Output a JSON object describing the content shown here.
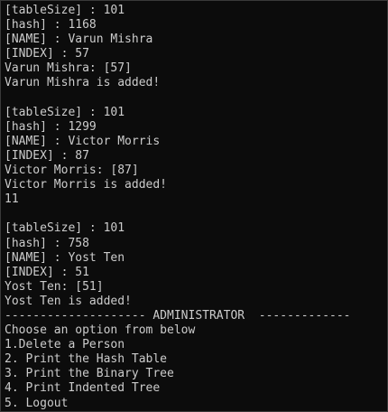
{
  "console": {
    "lines": [
      "[tableSize] : 101",
      "[hash] : 1168",
      "[NAME] : Varun Mishra",
      "[INDEX] : 57",
      "Varun Mishra: [57]",
      "Varun Mishra is added!",
      "",
      "[tableSize] : 101",
      "[hash] : 1299",
      "[NAME] : Victor Morris",
      "[INDEX] : 87",
      "Victor Morris: [87]",
      "Victor Morris is added!",
      "11",
      "",
      "[tableSize] : 101",
      "[hash] : 758",
      "[NAME] : Yost Ten",
      "[INDEX] : 51",
      "Yost Ten: [51]",
      "Yost Ten is added!",
      "-------------------- ADMINISTRATOR  -------------",
      "Choose an option from below",
      "1.Delete a Person",
      "2. Print the Hash Table",
      "3. Print the Binary Tree",
      "4. Print Indented Tree",
      "5. Logout"
    ]
  }
}
